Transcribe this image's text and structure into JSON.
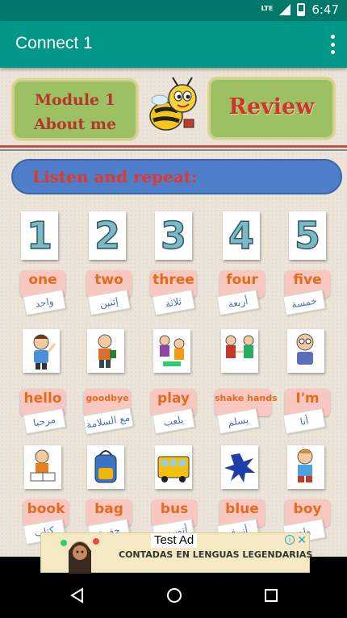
{
  "status_bar": {
    "network": "LTE",
    "time": "6:47"
  },
  "app_bar": {
    "title": "Connect 1"
  },
  "header": {
    "module_line1": "Module 1",
    "module_line2": "About me",
    "review_label": "Review"
  },
  "banner": {
    "text": "Listen and repeat:"
  },
  "numbers": [
    "1",
    "2",
    "3",
    "4",
    "5"
  ],
  "row1": [
    {
      "en": "one",
      "ar": "واحد"
    },
    {
      "en": "two",
      "ar": "إثنين"
    },
    {
      "en": "three",
      "ar": "ثلاثة"
    },
    {
      "en": "four",
      "ar": "أربعة"
    },
    {
      "en": "five",
      "ar": "خمسة"
    }
  ],
  "row2_pictures": [
    "boy-waving-icon",
    "boy-with-bag-icon",
    "children-playing-icon",
    "boys-shaking-hands-icon",
    "boy-introducing-icon"
  ],
  "row2": [
    {
      "en": "hello",
      "ar": "مرحبا"
    },
    {
      "en": "goodbye",
      "ar": "مع السلامة"
    },
    {
      "en": "play",
      "ar": "يلعب"
    },
    {
      "en": "shake hands",
      "ar": "يسلم"
    },
    {
      "en": "I'm",
      "ar": "أنا"
    }
  ],
  "row3_pictures": [
    "boy-reading-book-icon",
    "school-bag-icon",
    "school-bus-icon",
    "blue-splash-icon",
    "boy-sitting-icon"
  ],
  "row3": [
    {
      "en": "book",
      "ar": "كتاب"
    },
    {
      "en": "bag",
      "ar": "حقيبة"
    },
    {
      "en": "bus",
      "ar": "أتوبيس"
    },
    {
      "en": "blue",
      "ar": "أزرق"
    },
    {
      "en": "boy",
      "ar": "ولد"
    }
  ],
  "ad": {
    "tag": "Test Ad",
    "headline": "CONTADAS EN LENGUAS LEGENDARIAS"
  },
  "colors": {
    "app_bar": "#009688",
    "status_bar": "#00796b",
    "module_box": "#9dc062",
    "banner": "#4f7fca",
    "label_text": "#e36b1f",
    "label_bg": "#f8c8c0"
  }
}
